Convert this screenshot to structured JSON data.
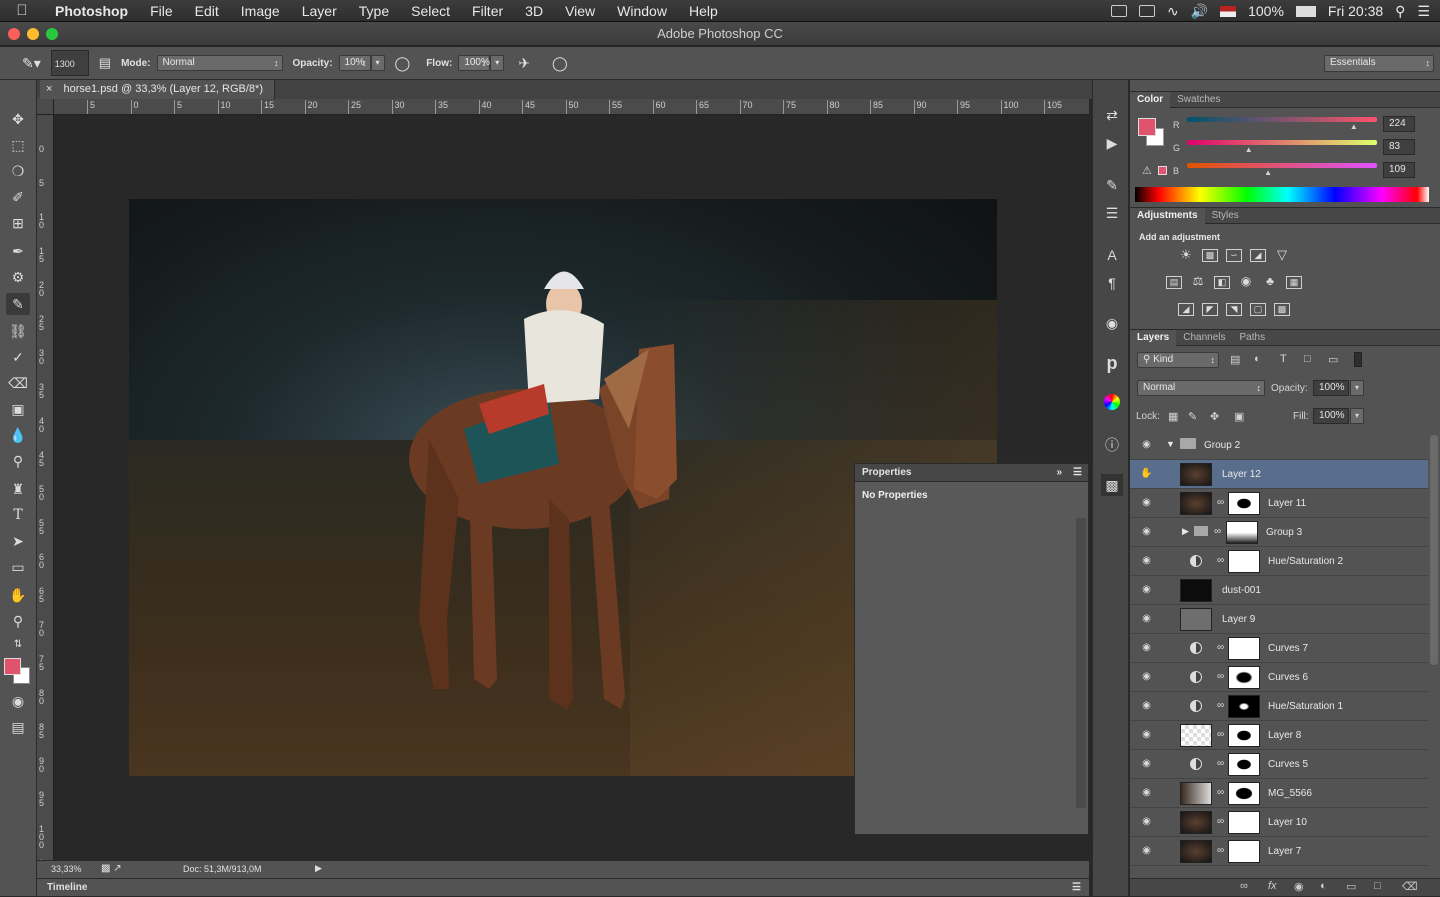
{
  "menubar": {
    "app": "Photoshop",
    "items": [
      "File",
      "Edit",
      "Image",
      "Layer",
      "Type",
      "Select",
      "Filter",
      "3D",
      "View",
      "Window",
      "Help"
    ],
    "battery": "100%",
    "clock": "Fri 20:38"
  },
  "window": {
    "title": "Adobe Photoshop CC"
  },
  "options": {
    "brush_size": "1300",
    "mode_label": "Mode:",
    "mode_value": "Normal",
    "opacity_label": "Opacity:",
    "opacity_value": "10%",
    "flow_label": "Flow:",
    "flow_value": "100%",
    "workspace": "Essentials"
  },
  "document": {
    "tab": "horse1.psd @ 33,3% (Layer 12, RGB/8*)",
    "ruler_top": [
      "5",
      "0",
      "5",
      "10",
      "15",
      "20",
      "25",
      "30",
      "35",
      "40",
      "45",
      "50",
      "55",
      "60",
      "65",
      "70",
      "75",
      "80",
      "85",
      "90",
      "95",
      "100",
      "105"
    ],
    "ruler_left": [
      "0",
      "5",
      "1 0",
      "1 5",
      "2 0",
      "2 5",
      "3 0",
      "3 5",
      "4 0",
      "4 5",
      "5 0",
      "5 5",
      "6 0",
      "6 5",
      "7 0",
      "7 5",
      "8 0",
      "8 5",
      "9 0",
      "9 5",
      "1 0 0",
      "1 0 5"
    ],
    "zoom": "33,33%",
    "doc_size": "Doc: 51,3M/913,0M"
  },
  "timeline": {
    "label": "Timeline"
  },
  "properties": {
    "title": "Properties",
    "empty": "No Properties"
  },
  "color_panel": {
    "tabs": [
      "Color",
      "Swatches"
    ],
    "r_label": "R",
    "g_label": "G",
    "b_label": "B",
    "r": "224",
    "g": "83",
    "b": "109",
    "r_fraction": 0.878,
    "g_fraction": 0.325,
    "b_fraction": 0.427,
    "foreground": "#e0536d"
  },
  "adjustments": {
    "tabs": [
      "Adjustments",
      "Styles"
    ],
    "heading": "Add an adjustment"
  },
  "layers_panel": {
    "tabs": [
      "Layers",
      "Channels",
      "Paths"
    ],
    "filter": "Kind",
    "blend": "Normal",
    "opacity_label": "Opacity:",
    "opacity": "100%",
    "lock_label": "Lock:",
    "fill_label": "Fill:",
    "fill": "100%",
    "layers": [
      {
        "name": "Group 2"
      },
      {
        "name": "Layer 12"
      },
      {
        "name": "Layer 11"
      },
      {
        "name": "Group 3"
      },
      {
        "name": "Hue/Saturation 2"
      },
      {
        "name": "dust-001"
      },
      {
        "name": "Layer 9"
      },
      {
        "name": "Curves 7"
      },
      {
        "name": "Curves 6"
      },
      {
        "name": "Hue/Saturation 1"
      },
      {
        "name": "Layer 8"
      },
      {
        "name": "Curves 5"
      },
      {
        "name": "MG_5566"
      },
      {
        "name": "Layer 10"
      },
      {
        "name": "Layer 7"
      }
    ]
  }
}
